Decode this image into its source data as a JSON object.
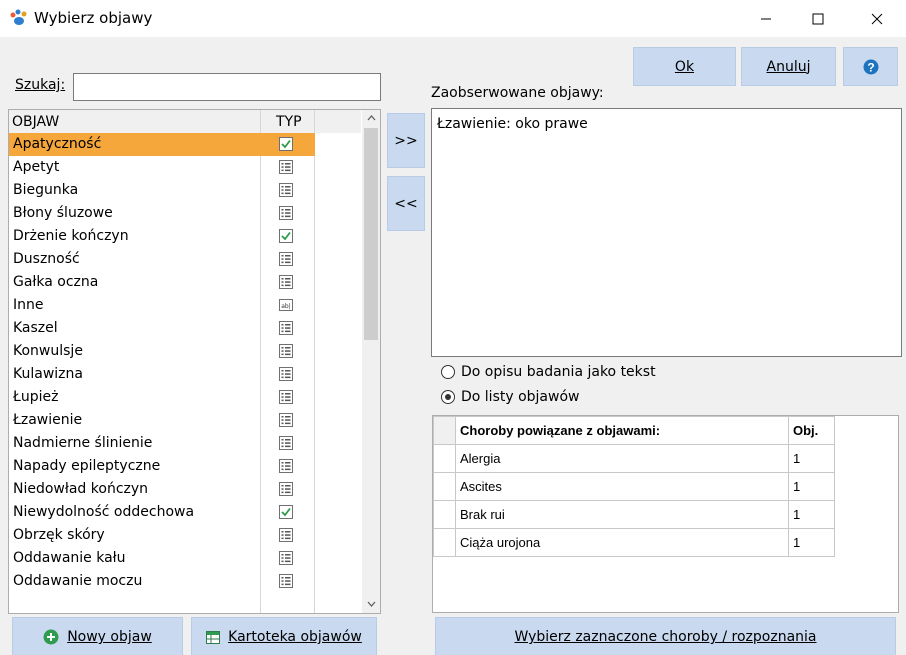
{
  "window": {
    "title": "Wybierz objawy"
  },
  "toolbar": {
    "ok_label": "Ok",
    "cancel_label": "Anuluj"
  },
  "search": {
    "label": "Szukaj:",
    "value": ""
  },
  "symptom_list": {
    "col_objaw": "OBJAW",
    "col_typ": "TYP",
    "items": [
      {
        "label": "Apatyczność",
        "type": "checkbox",
        "selected": true
      },
      {
        "label": "Apetyt",
        "type": "list"
      },
      {
        "label": "Biegunka",
        "type": "list"
      },
      {
        "label": "Błony śluzowe",
        "type": "list"
      },
      {
        "label": "Drżenie kończyn",
        "type": "checkbox"
      },
      {
        "label": "Duszność",
        "type": "list"
      },
      {
        "label": "Gałka oczna",
        "type": "list"
      },
      {
        "label": "Inne",
        "type": "text"
      },
      {
        "label": "Kaszel",
        "type": "list"
      },
      {
        "label": "Konwulsje",
        "type": "list"
      },
      {
        "label": "Kulawizna",
        "type": "list"
      },
      {
        "label": "Łupież",
        "type": "list"
      },
      {
        "label": "Łzawienie",
        "type": "list"
      },
      {
        "label": "Nadmierne ślinienie",
        "type": "list"
      },
      {
        "label": "Napady epileptyczne",
        "type": "list"
      },
      {
        "label": "Niedowład kończyn",
        "type": "list"
      },
      {
        "label": "Niewydolność oddechowa",
        "type": "checkbox"
      },
      {
        "label": "Obrzęk skóry",
        "type": "list"
      },
      {
        "label": "Oddawanie kału",
        "type": "list"
      },
      {
        "label": "Oddawanie moczu",
        "type": "list"
      }
    ]
  },
  "transfer": {
    "add_label": ">>",
    "remove_label": "<<"
  },
  "observed": {
    "label": "Zaobserwowane objawy:",
    "text": "Łzawienie: oko prawe"
  },
  "mode": {
    "option_text": "Do opisu badania jako tekst",
    "option_list": "Do listy objawów",
    "selected": "list"
  },
  "diseases": {
    "col_name": "Choroby powiązane z objawami:",
    "col_obj": "Obj.",
    "rows": [
      {
        "name": "Alergia",
        "obj": "1"
      },
      {
        "name": "Ascites",
        "obj": "1"
      },
      {
        "name": "Brak rui",
        "obj": "1"
      },
      {
        "name": "Ciąża urojona",
        "obj": "1"
      }
    ]
  },
  "bottom": {
    "new_symptom": "Nowy objaw",
    "symptom_catalog": "Kartoteka objawów",
    "select_diseases": "Wybierz zaznaczone choroby / rozpoznania"
  },
  "colors": {
    "selection": "#f5a73c",
    "button": "#c9daf0",
    "help_icon": "#1e73be",
    "check": "#2e9b4e"
  }
}
